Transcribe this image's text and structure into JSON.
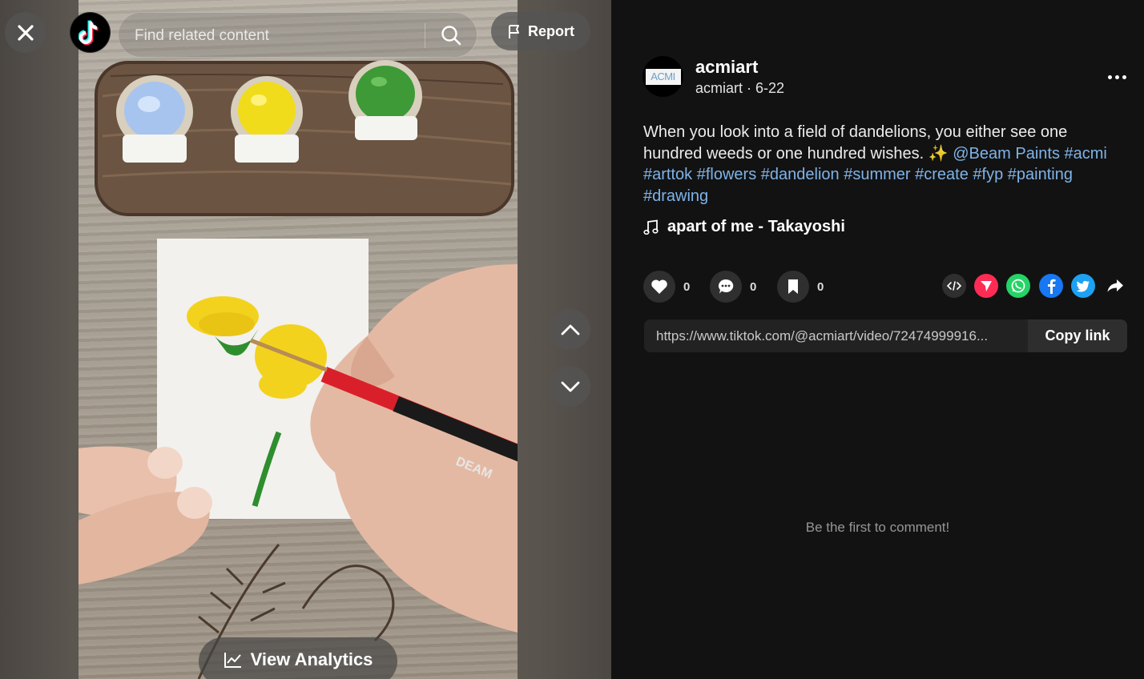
{
  "topbar": {
    "search_placeholder": "Find related content",
    "report_label": "Report"
  },
  "video": {
    "analytics_label": "View Analytics",
    "brush_text": "DEAM"
  },
  "author": {
    "display_name": "acmiart",
    "meta": "acmiart · 6-22",
    "avatar_text": "ACMI"
  },
  "caption": {
    "text_part1": "When you look into a field of dandelions, you either see one hundred weeds or one hundred wishes. ✨ ",
    "hashtags": [
      "@Beam Paints",
      "#acmi",
      "#arttok",
      "#flowers",
      "#dandelion",
      "#summer",
      "#create",
      "#fyp",
      "#painting",
      "#drawing"
    ]
  },
  "music": {
    "title": "apart of me - Takayoshi"
  },
  "actions": {
    "likes": "0",
    "comments": "0",
    "saves": "0"
  },
  "share": {
    "icons": [
      "embed-icon",
      "send-icon",
      "whatsapp-icon",
      "facebook-icon",
      "twitter-icon",
      "share-arrow-icon"
    ],
    "colors": {
      "send": "#fe2c55",
      "whatsapp": "#25d366",
      "facebook": "#1877f2",
      "twitter": "#1da1f2"
    }
  },
  "link": {
    "url": "https://www.tiktok.com/@acmiart/video/72474999916...",
    "copy_label": "Copy link"
  },
  "comments": {
    "empty_text": "Be the first to comment!"
  },
  "colors": {
    "hashtag": "#7fb3e8",
    "background": "#121212"
  }
}
